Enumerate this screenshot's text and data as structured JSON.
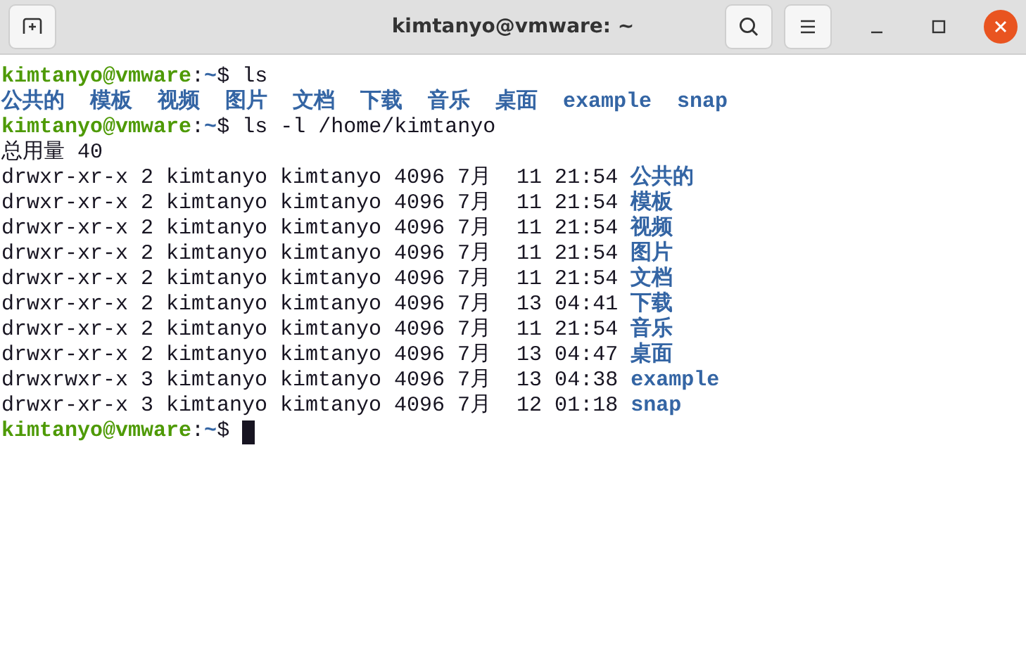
{
  "window": {
    "title": "kimtanyo@vmware: ~"
  },
  "lines": [
    {
      "kind": "prompt",
      "user": "kimtanyo@vmware",
      "colon": ":",
      "path": "~",
      "sign": "$",
      "command": "ls"
    },
    {
      "kind": "listing",
      "entries": [
        "公共的",
        "模板",
        "视频",
        "图片",
        "文档",
        "下载",
        "音乐",
        "桌面",
        "example",
        "snap"
      ]
    },
    {
      "kind": "prompt",
      "user": "kimtanyo@vmware",
      "colon": ":",
      "path": "~",
      "sign": "$",
      "command": "ls -l /home/kimtanyo"
    },
    {
      "kind": "text",
      "text": "总用量 40"
    },
    {
      "kind": "long",
      "info": "drwxr-xr-x 2 kimtanyo kimtanyo 4096 7月  11 21:54",
      "name": "公共的"
    },
    {
      "kind": "long",
      "info": "drwxr-xr-x 2 kimtanyo kimtanyo 4096 7月  11 21:54",
      "name": "模板"
    },
    {
      "kind": "long",
      "info": "drwxr-xr-x 2 kimtanyo kimtanyo 4096 7月  11 21:54",
      "name": "视频"
    },
    {
      "kind": "long",
      "info": "drwxr-xr-x 2 kimtanyo kimtanyo 4096 7月  11 21:54",
      "name": "图片"
    },
    {
      "kind": "long",
      "info": "drwxr-xr-x 2 kimtanyo kimtanyo 4096 7月  11 21:54",
      "name": "文档"
    },
    {
      "kind": "long",
      "info": "drwxr-xr-x 2 kimtanyo kimtanyo 4096 7月  13 04:41",
      "name": "下载"
    },
    {
      "kind": "long",
      "info": "drwxr-xr-x 2 kimtanyo kimtanyo 4096 7月  11 21:54",
      "name": "音乐"
    },
    {
      "kind": "long",
      "info": "drwxr-xr-x 2 kimtanyo kimtanyo 4096 7月  13 04:47",
      "name": "桌面"
    },
    {
      "kind": "long",
      "info": "drwxrwxr-x 3 kimtanyo kimtanyo 4096 7月  13 04:38",
      "name": "example"
    },
    {
      "kind": "long",
      "info": "drwxr-xr-x 3 kimtanyo kimtanyo 4096 7月  12 01:18",
      "name": "snap"
    },
    {
      "kind": "prompt",
      "user": "kimtanyo@vmware",
      "colon": ":",
      "path": "~",
      "sign": "$",
      "cursor": true
    }
  ]
}
